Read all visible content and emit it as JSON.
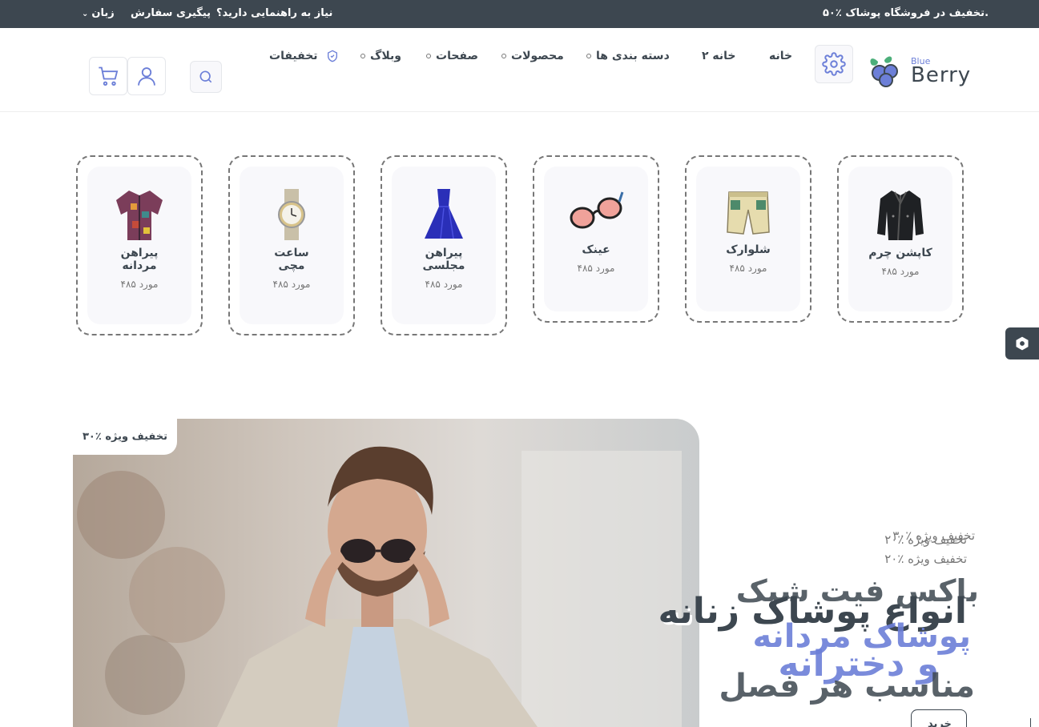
{
  "topbar": {
    "promo": "۵۰٪ تخفیف در فروشگاه پوشاک.",
    "help": "نیاز به راهنمایی دارید؟",
    "track": "پیگیری سفارش",
    "language": "زبان"
  },
  "logo": {
    "small": "Blue",
    "main": "Berry"
  },
  "nav": {
    "home": "خانه",
    "home2": "خانه ۲",
    "categories": "دسته بندی ها",
    "products": "محصولات",
    "pages": "صفحات",
    "blog": "وبلاگ",
    "offers": "تخفیفات"
  },
  "categories": [
    {
      "name": "کاپشن چرم",
      "count": "۴۸۵ مورد"
    },
    {
      "name": "شلوارک",
      "count": "۴۸۵ مورد"
    },
    {
      "name": "عینک",
      "count": "۴۸۵ مورد"
    },
    {
      "name": "پیراهن مجلسی",
      "count": "۴۸۵ مورد"
    },
    {
      "name": "ساعت مچی",
      "count": "۴۸۵ مورد"
    },
    {
      "name": "پیراهن مردانه",
      "count": "۴۸۵ مورد"
    }
  ],
  "hero": {
    "badge": "۳۰٪ تخفیف ویژه",
    "kicker1": "۳۰٪ تخفیف ویژه",
    "kicker2": "۲۰٪ تخفیف ویژه",
    "kicker3": "۲۰٪ تخفیف ویژه",
    "title_a": "باکس فیت شیک",
    "title_b": "انواع پوشاک زنانه",
    "accent_a": "پوشاک مردانه",
    "accent_b": "و دخترانه",
    "title_c": "مناسب هر فصل",
    "button": "خرید"
  },
  "colors": {
    "dark": "#3d4750",
    "accent": "#6c7fd8",
    "muted": "#777777"
  }
}
